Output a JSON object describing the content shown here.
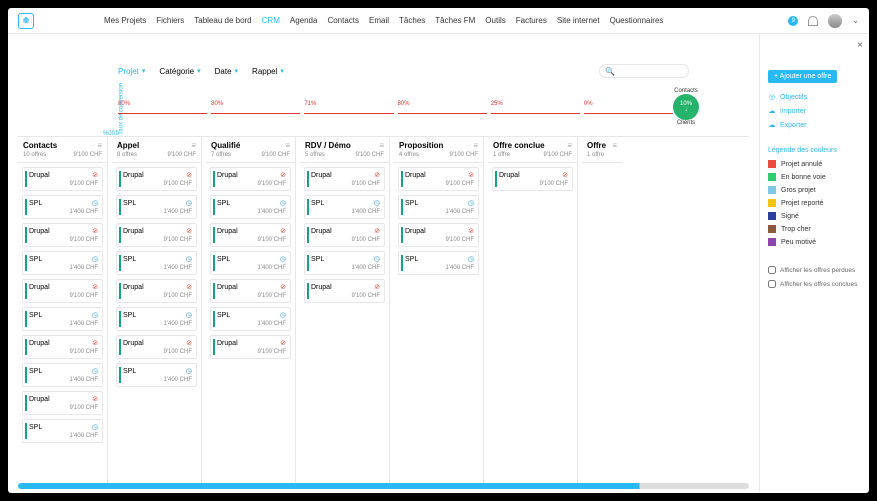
{
  "topbar": {
    "menu": [
      "Mes Projets",
      "Fichiers",
      "Tableau de bord",
      "CRM",
      "Agenda",
      "Contacts",
      "Email",
      "Tâches",
      "Tâches FM",
      "Outils",
      "Factures",
      "Site internet",
      "Questionnaires"
    ],
    "active": 3,
    "notif": "9"
  },
  "filters": {
    "items": [
      {
        "label": "Projet",
        "brand": true
      },
      {
        "label": "Catégorie"
      },
      {
        "label": "Date"
      },
      {
        "label": "Rappel"
      }
    ]
  },
  "summary": {
    "vlabel": "Taux de conversion",
    "vpct": "100%",
    "circle": {
      "topLabel": "Contacts",
      "pct": "10%",
      "arrow": "↓",
      "botLabel": "Clients"
    },
    "cols": [
      {
        "pct": "80%"
      },
      {
        "pct": "80%"
      },
      {
        "pct": "71%"
      },
      {
        "pct": "80%"
      },
      {
        "pct": "25%"
      },
      {
        "pct": "0%"
      }
    ]
  },
  "kanban": {
    "currency": "CHF",
    "columns": [
      {
        "title": "Contacts",
        "count": "10 offres",
        "total": "9'100 CHF",
        "cards": 10
      },
      {
        "title": "Appel",
        "count": "8 offres",
        "total": "9'100 CHF",
        "cards": 8
      },
      {
        "title": "Qualifié",
        "count": "7 offres",
        "total": "9'100 CHF",
        "cards": 7
      },
      {
        "title": "RDV / Démo",
        "count": "5 offres",
        "total": "9'100 CHF",
        "cards": 5
      },
      {
        "title": "Proposition",
        "count": "4 offres",
        "total": "9'100 CHF",
        "cards": 4
      },
      {
        "title": "Offre conclue",
        "count": "1 offre",
        "total": "9'100 CHF",
        "cards": 1
      },
      {
        "title": "Offre",
        "count": "1 offre",
        "total": "",
        "cards": 0,
        "narrow": true
      }
    ],
    "cardTypes": [
      {
        "name": "Drupal",
        "price": "9'100 CHF",
        "color": "red",
        "icon": "⊘"
      },
      {
        "name": "SPL",
        "price": "1'400 CHF",
        "color": "blue",
        "icon": "◷"
      }
    ]
  },
  "side": {
    "add": "+ Ajouter une offre",
    "links": [
      {
        "icon": "◎",
        "label": "Objectifs"
      },
      {
        "icon": "☁",
        "label": "Importer"
      },
      {
        "icon": "☁",
        "label": "Exporter"
      }
    ],
    "legendTitle": "Légende des couleurs",
    "legend": [
      {
        "c": "#e74c3c",
        "t": "Projet annulé"
      },
      {
        "c": "#2ecc71",
        "t": "En bonne voie"
      },
      {
        "c": "#7ec8e3",
        "t": "Gros projet"
      },
      {
        "c": "#f1c40f",
        "t": "Projet reporté"
      },
      {
        "c": "#2c3e9e",
        "t": "Signé"
      },
      {
        "c": "#8b5a3c",
        "t": "Trop cher"
      },
      {
        "c": "#8e44ad",
        "t": "Peu motivé"
      }
    ],
    "checks": [
      "Afficher les offres perdues",
      "Afficher les offres conclues"
    ]
  }
}
